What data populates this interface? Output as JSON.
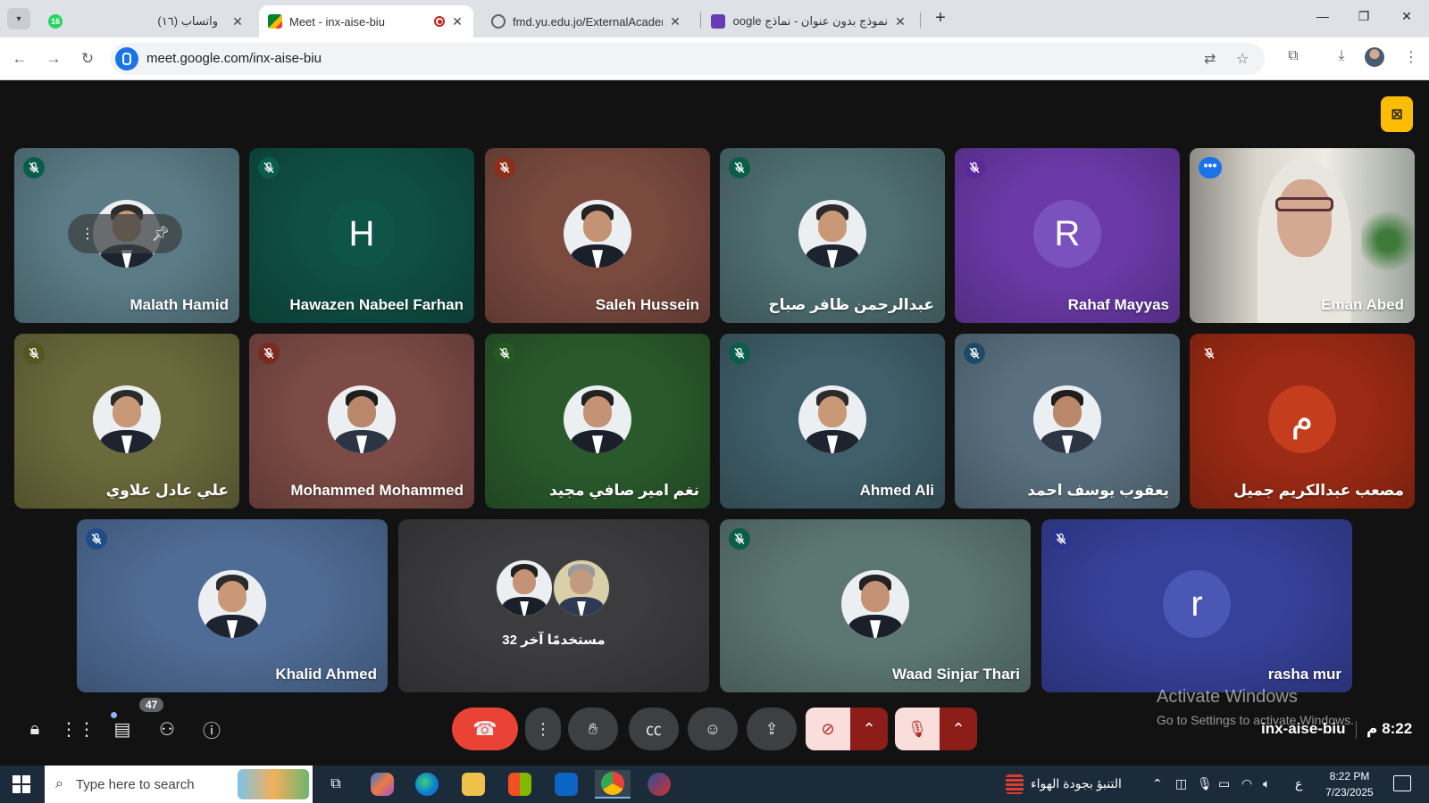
{
  "browser": {
    "tabs": [
      {
        "title": "(١٦) واتساب",
        "favicon_color": "#25d366",
        "badge": "16",
        "active": false
      },
      {
        "title": "Meet - inx-aise-biu",
        "favicon_color": "#00832d",
        "active": true,
        "recording": true
      },
      {
        "title": "fmd.yu.edu.jo/ExternalAcademi",
        "favicon_color": "#5f6368",
        "active": false
      },
      {
        "title": "نموذج بدون عنوان - نماذج Google",
        "favicon_color": "#673ab7",
        "active": false
      }
    ],
    "url": "meet.google.com/inx-aise-biu"
  },
  "colors": {
    "meet_bg": "#121212",
    "hangup": "#ea4335",
    "accent": "#8ab4f8",
    "no_camera_button": "#fbbc04"
  },
  "tiles": [
    {
      "name": "Malath Hamid",
      "bg": "#5b7c87",
      "mute_color": "#0b5c4a",
      "kind": "photo"
    },
    {
      "name": "Hawazen Nabeel Farhan",
      "bg": "#0f4f44",
      "mute_color": "#0b5c4a",
      "kind": "letter",
      "letter": "H",
      "letter_bg": "#0f5547"
    },
    {
      "name": "Saleh Hussein",
      "bg": "#7a4a3f",
      "mute_color": "#8c2f1a",
      "kind": "photo"
    },
    {
      "name": "عبدالرحمن ظافر صباح",
      "bg": "#4f6f72",
      "mute_color": "#0b5c4a",
      "kind": "photo"
    },
    {
      "name": "Rahaf Mayyas",
      "bg": "#6b3aa8",
      "mute_color": "#5a2a9a",
      "kind": "letter",
      "letter": "R",
      "letter_bg": "#7b52bd"
    },
    {
      "name": "Eman Abed",
      "bg": "#c9c4b8",
      "kind": "video",
      "speaking": true
    },
    {
      "name": "علي عادل علاوي",
      "bg": "#6b6a3c",
      "mute_color": "#55551f",
      "kind": "photo"
    },
    {
      "name": "Mohammed Mohammed",
      "bg": "#7d4b45",
      "mute_color": "#7a2a20",
      "kind": "photo"
    },
    {
      "name": "نغم امير صافي مجيد",
      "bg": "#2a5a2c",
      "mute_color": "#245a22",
      "kind": "photo"
    },
    {
      "name": "Ahmed Ali",
      "bg": "#3f5f6a",
      "mute_color": "#0b5c4a",
      "kind": "photo"
    },
    {
      "name": "يعقوب يوسف احمد",
      "bg": "#5a7080",
      "mute_color": "#1f4a66",
      "kind": "photo"
    },
    {
      "name": "مصعب عبدالكريم جميل",
      "bg": "#9c2a14",
      "mute_color": "#8c2410",
      "kind": "letter",
      "letter": "م",
      "letter_bg": "#c43d1c"
    },
    {
      "name": "Khalid Ahmed",
      "bg": "#4f6c96",
      "mute_color": "#1e4d8a",
      "kind": "photo"
    },
    {
      "name": "32 مستخدمًا آخر",
      "bg": "#3c3c3f",
      "kind": "others"
    },
    {
      "name": "Waad Sinjar Thari",
      "bg": "#5c7772",
      "mute_color": "#0b5c4a",
      "kind": "photo"
    },
    {
      "name": "rasha mur",
      "bg": "#36419a",
      "mute_color": "#2a3590",
      "kind": "letter",
      "letter": "r",
      "letter_bg": "#4a57b4"
    }
  ],
  "controls": {
    "participants_count": "47",
    "meeting_code": "inx-aise-biu",
    "meeting_time": "8:22 م"
  },
  "activation": {
    "title": "Activate Windows",
    "subtitle": "Go to Settings to activate Windows."
  },
  "taskbar": {
    "search_placeholder": "Type here to search",
    "weather_text": "التنبؤ بجودة الهواء",
    "ime": "ع",
    "time": "8:22 PM",
    "date": "7/23/2025"
  }
}
